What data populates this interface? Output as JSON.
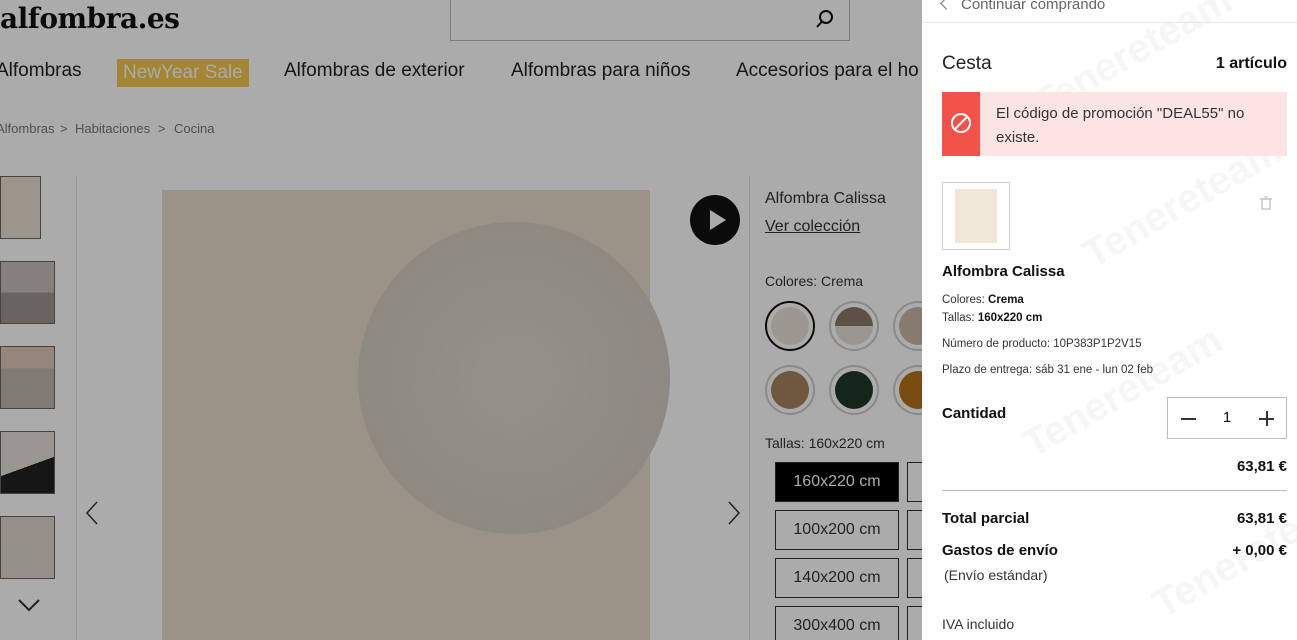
{
  "site": {
    "logo": "alfombra.es"
  },
  "nav": {
    "items": [
      "Alfombras",
      "NewYear Sale",
      "Alfombras de exterior",
      "Alfombras para niños",
      "Accesorios para el ho"
    ]
  },
  "breadcrumb": [
    "Alfombras",
    ">",
    "Habitaciones",
    ">",
    "Cocina"
  ],
  "product": {
    "title": "Alfombra Calissa",
    "collection_link": "Ver colección",
    "colors_label": "Colores: Crema",
    "sizes_label": "Tallas: 160x220 cm",
    "sizes": [
      "160x220 cm",
      "100x200 cm",
      "140x200 cm",
      "300x400 cm"
    ],
    "swatch_colors": [
      "#e8e2d8",
      "#6b5a4a",
      "#c9b7a6",
      "#a8825e",
      "#1f3a2a",
      "#b5721e"
    ]
  },
  "cart": {
    "back_label": "Continuar comprando",
    "title": "Cesta",
    "count": "1 artículo",
    "alert": "El código de promoción \"DEAL55\" no existe.",
    "item": {
      "name": "Alfombra Calissa",
      "colors_label": "Colores:",
      "colors_value": "Crema",
      "sizes_label": "Tallas:",
      "sizes_value": "160x220 cm",
      "sku_label": "Número de producto:",
      "sku_value": "10P383P1P2V15",
      "delivery_label": "Plazo de entrega:",
      "delivery_value": "sáb 31 ene - lun 02 feb",
      "quantity_label": "Cantidad",
      "quantity": "1",
      "price": "63,81 €"
    },
    "subtotal_label": "Total parcial",
    "subtotal": "63,81 €",
    "shipping_label": "Gastos de envío",
    "shipping": "+ 0,00 €",
    "shipping_note": "(Envío estándar)",
    "vat_note": "IVA incluido"
  },
  "colors": {
    "alert_red": "#f2524a",
    "alert_bg": "#fde4e4",
    "sale": "#f3c74c"
  }
}
